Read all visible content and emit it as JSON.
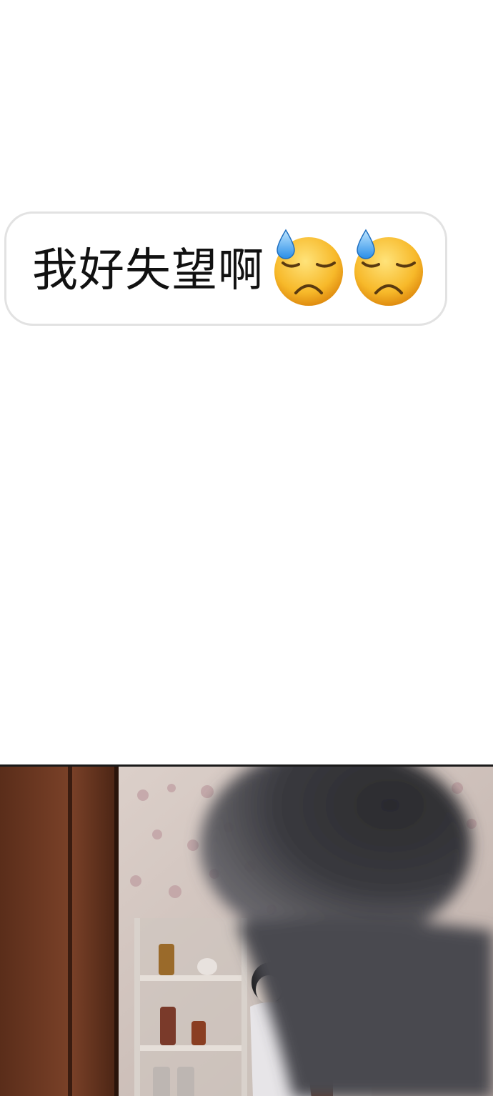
{
  "bubble": {
    "text": "我好失望啊"
  },
  "emojis": [
    {
      "icon": "downcast-face-with-sweat-icon"
    },
    {
      "icon": "downcast-face-with-sweat-icon"
    }
  ],
  "colors": {
    "background": "#ffffff",
    "bubble_border": "#e2e2e2",
    "text": "#111111",
    "wood": "#6e3a24",
    "wallpaper": "#d8ccc6"
  }
}
